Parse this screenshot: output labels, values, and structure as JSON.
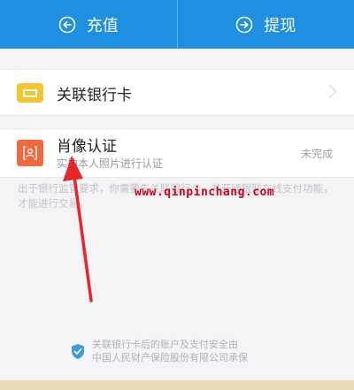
{
  "topbar": {
    "recharge_label": "充值",
    "withdraw_label": "提现"
  },
  "bank_card": {
    "label": "关联银行卡"
  },
  "portrait": {
    "title": "肖像认证",
    "subtitle": "实拍本人照片进行认证",
    "status": "未完成"
  },
  "note": {
    "text": "出于银行监管要求，你需要先关联银行卡，并开通银联在线支付功能，才能进行交易。"
  },
  "watermark": {
    "text": "www.qinpinchang.com"
  },
  "footer": {
    "line1": "关联银行卡后的账户及支付安全由",
    "line2": "中国人民财产保险股份有限公司承保"
  },
  "colors": {
    "topbar": "#1f8fe2",
    "bank_icon": "#f5c531",
    "portrait_icon": "#f0683d",
    "annotation_arrow": "#e8262a"
  }
}
